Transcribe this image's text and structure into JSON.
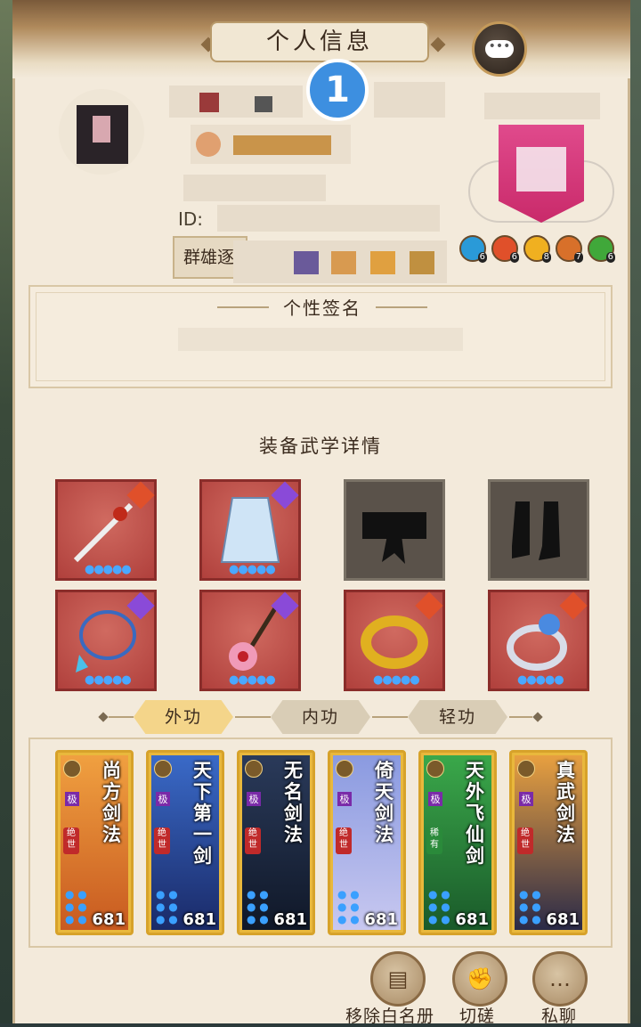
{
  "header": {
    "title": "个人信息"
  },
  "profile": {
    "id_prefix": "ID:",
    "guild_label": "群雄逐"
  },
  "signature": {
    "title": "个性签名"
  },
  "equipment": {
    "title": "装备武学详情",
    "slots": [
      {
        "name": "sword",
        "icon": "sword-icon",
        "filled": true
      },
      {
        "name": "robe",
        "icon": "robe-icon",
        "filled": true
      },
      {
        "name": "belt",
        "icon": "belt-icon",
        "filled": false
      },
      {
        "name": "boots",
        "icon": "boots-icon",
        "filled": false
      },
      {
        "name": "necklace",
        "icon": "necklace-icon",
        "filled": true
      },
      {
        "name": "hairpin",
        "icon": "hairpin-icon",
        "filled": true
      },
      {
        "name": "bracelet",
        "icon": "bracelet-icon",
        "filled": true
      },
      {
        "name": "ring",
        "icon": "ring-icon",
        "filled": true
      }
    ]
  },
  "tabs": [
    {
      "label": "外功",
      "active": true
    },
    {
      "label": "内功",
      "active": false
    },
    {
      "label": "轻功",
      "active": false
    }
  ],
  "skills": [
    {
      "name": "尚方剑法",
      "tier": "极",
      "rarity": "绝世",
      "level": "681"
    },
    {
      "name": "天下第一剑",
      "tier": "极",
      "rarity": "绝世",
      "level": "681"
    },
    {
      "name": "无名剑法",
      "tier": "极",
      "rarity": "绝世",
      "level": "681"
    },
    {
      "name": "倚天剑法",
      "tier": "极",
      "rarity": "绝世",
      "level": "681"
    },
    {
      "name": "天外飞仙剑",
      "tier": "极",
      "rarity": "稀有",
      "level": "681"
    },
    {
      "name": "真武剑法",
      "tier": "极",
      "rarity": "绝世",
      "level": "681"
    }
  ],
  "actions": {
    "remove_whitelist": "移除白名册",
    "spar": "切磋",
    "private_chat": "私聊"
  },
  "orb_levels": [
    "6",
    "6",
    "8",
    "7",
    "6"
  ],
  "colors": {
    "panel": "#f3eadb",
    "accent": "#d7a22a",
    "text": "#3b2b1e"
  }
}
